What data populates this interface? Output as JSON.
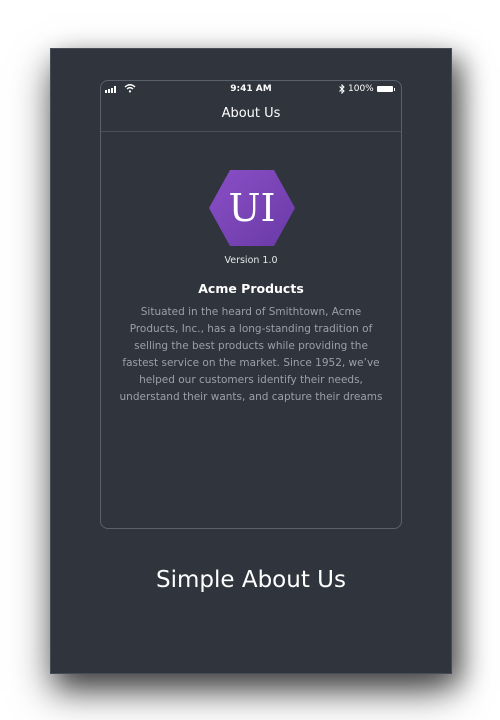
{
  "status_bar": {
    "time": "9:41 AM",
    "battery": "100%"
  },
  "header": {
    "title": "About Us"
  },
  "app": {
    "logo_text": "UI",
    "version": "Version 1.0",
    "company_name": "Acme Products",
    "description": "Situated in the heard of Smithtown, Acme Products, Inc., has a long-standing tradition of selling the best products while providing the fastest service on the market. Since 1952, we’ve helped our customers identify their needs, understand their wants, and capture their dreams"
  },
  "caption": "Simple About Us",
  "colors": {
    "background": "#2f343d",
    "logo_purple": "#7a45b5",
    "text_muted": "#9aa0a9"
  }
}
